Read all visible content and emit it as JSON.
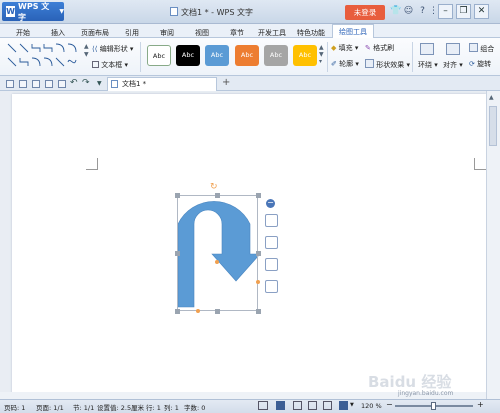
{
  "titlebar": {
    "app_name": "WPS 文字",
    "doc_title": "文档1 * - WPS 文字",
    "login_button": "未登录",
    "help_icon": "?"
  },
  "menu": {
    "tabs": [
      "开始",
      "插入",
      "页面布局",
      "引用",
      "审阅",
      "视图",
      "章节",
      "开发工具",
      "特色功能"
    ],
    "active_tab": "绘图工具"
  },
  "ribbon": {
    "edit_shape": "编辑形状",
    "text_box": "文本框",
    "style_label": "Abc",
    "style_colors": [
      "#ffffff",
      "#000000",
      "#5b9bd5",
      "#ed7d31",
      "#a5a5a5",
      "#ffc000"
    ],
    "fill": "填充",
    "format_brush": "格式刷",
    "outline": "轮廓",
    "shape_effects": "形状效果",
    "wrap": "环绕",
    "align": "对齐",
    "group": "组合",
    "rotate": "旋转"
  },
  "doc_tabs": {
    "tab_name": "文档1 *",
    "add_tab": "+"
  },
  "shape": {
    "type": "U-turn arrow",
    "fill_color": "#5b9bd5"
  },
  "status": {
    "page_num": "页码: 1",
    "pages": "页面: 1/1",
    "section": "节: 1/1",
    "setting": "设置值: 2.5厘米",
    "row": "行: 1",
    "col": "列: 1",
    "words": "字数: 0",
    "zoom": "120 %"
  },
  "watermark": "Baidu 经验",
  "watermark_url": "jingyan.baidu.com"
}
